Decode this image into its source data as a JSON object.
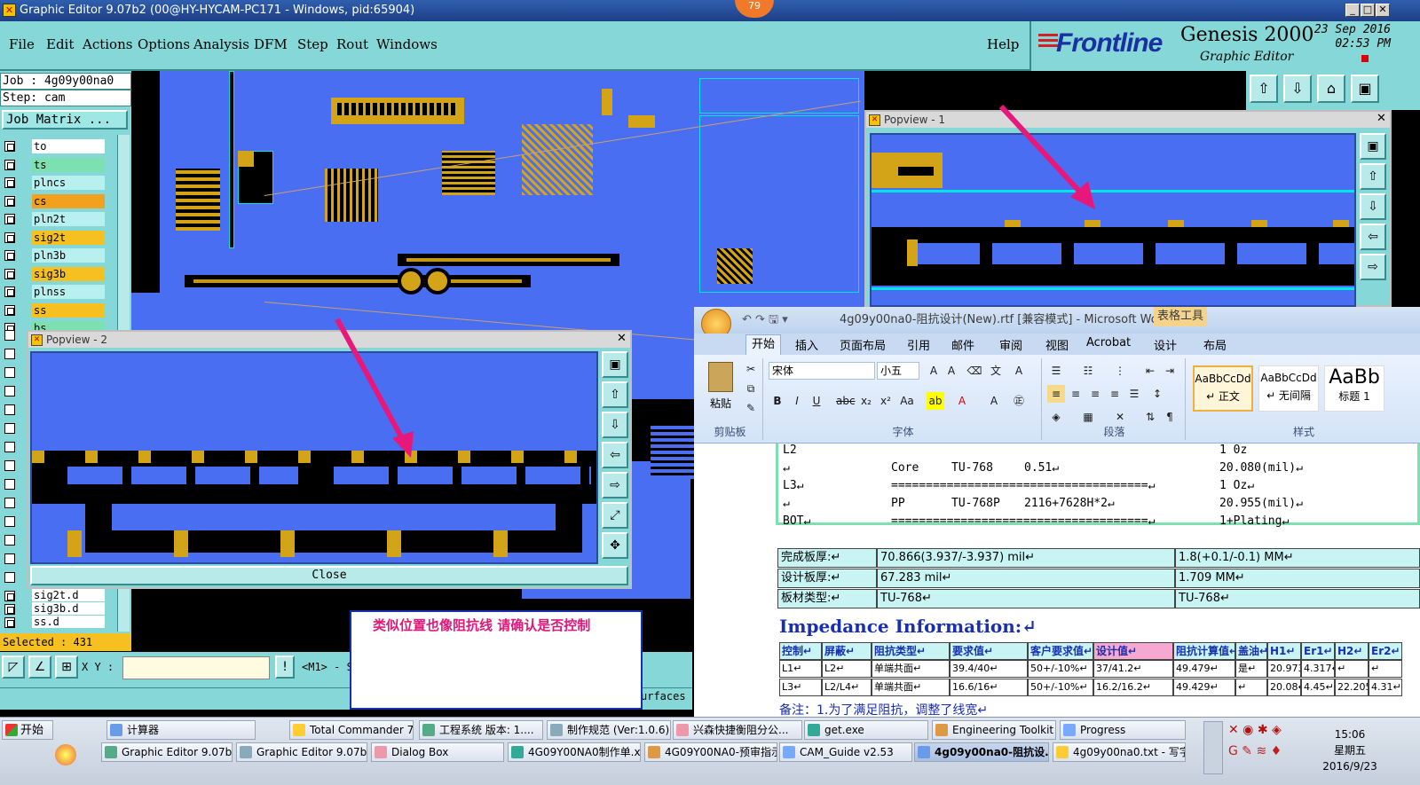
{
  "window": {
    "title": "Graphic Editor 9.07b2 (00@HY-HYCAM-PC171 - Windows, pid:65904)",
    "notification_count": "79"
  },
  "menu": [
    "File",
    "Edit",
    "Actions",
    "Options",
    "Analysis",
    "DFM",
    "Step",
    "Rout",
    "Windows"
  ],
  "help_label": "Help",
  "brand": {
    "frontline": "Frontline",
    "product": "Genesis 2000",
    "subtitle": "Graphic Editor",
    "date": "23 Sep 2016",
    "time": "02:53 PM"
  },
  "job": {
    "job_line": "Job : 4g09y00na0",
    "step_line": "Step: cam",
    "matrix_button": "Job Matrix ..."
  },
  "layers": [
    {
      "name": "to",
      "color": "white"
    },
    {
      "name": "ts",
      "color": "green"
    },
    {
      "name": "plncs",
      "color": "cyan"
    },
    {
      "name": "cs",
      "color": "red"
    },
    {
      "name": "pln2t",
      "color": "cyan"
    },
    {
      "name": "sig2t",
      "color": "yellow"
    },
    {
      "name": "pln3b",
      "color": "cyan"
    },
    {
      "name": "sig3b",
      "color": "yellow"
    },
    {
      "name": "plnss",
      "color": "cyan"
    },
    {
      "name": "ss",
      "color": "yellow"
    },
    {
      "name": "bs",
      "color": "green"
    }
  ],
  "layers_bottom": [
    "sig2t.d",
    "sig3b.d",
    "ss.d"
  ],
  "selected_label": "Selected : 431",
  "coords": {
    "xy_label": "X Y :",
    "m1_text": "<M1> - S"
  },
  "surfaces_label": "urfaces",
  "popview1": {
    "title": "Popview - 1"
  },
  "popview2": {
    "title": "Popview - 2",
    "close_label": "Close"
  },
  "note": {
    "text": "类似位置也像阻抗线 请确认是否控制"
  },
  "word": {
    "title": "4g09y00na0-阻抗设计(New).rtf [兼容模式] - Microsoft Wo...",
    "context_tab": "表格工具",
    "tabs": [
      "开始",
      "插入",
      "页面布局",
      "引用",
      "邮件",
      "审阅",
      "视图",
      "Acrobat",
      "设计",
      "布局"
    ],
    "font_name": "宋体",
    "font_size": "小五",
    "paste_label": "粘贴",
    "groups": [
      "剪贴板",
      "字体",
      "段落",
      "样式"
    ],
    "styles": [
      {
        "sample": "AaBbCcDd",
        "name": "↵ 正文"
      },
      {
        "sample": "AaBbCcDd",
        "name": "↵ 无间隔"
      },
      {
        "sample": "AaBb",
        "name": "标题 1"
      }
    ],
    "stackup": [
      {
        "c1": "L2",
        "c2": "",
        "c3": "",
        "c4": "",
        "c5": "1 0z"
      },
      {
        "c1": "↵",
        "c2": "Core",
        "c3": "TU-768",
        "c4": "0.51↵",
        "c5": "20.080(mil)↵"
      },
      {
        "c1": "L3↵",
        "c2": "=====================================↵",
        "c3": "",
        "c4": "",
        "c5": "1 Oz↵"
      },
      {
        "c1": "↵",
        "c2": "PP",
        "c3": "TU-768P",
        "c4": "2116+7628H*2↵",
        "c5": "20.955(mil)↵"
      },
      {
        "c1": "BOT↵",
        "c2": "=====================================↵",
        "c3": "",
        "c4": "",
        "c5": "1+Plating↵"
      }
    ],
    "thickness": [
      [
        "完成板厚:↵",
        "70.866(3.937/-3.937) mil↵",
        "1.8(+0.1/-0.1) MM↵"
      ],
      [
        "设计板厚:↵",
        "67.283 mil↵",
        "1.709 MM↵"
      ],
      [
        "板材类型:↵",
        "TU-768↵",
        "TU-768↵"
      ]
    ],
    "impedance_heading": "Impedance Information:↵",
    "imp_headers": [
      "控制↵",
      "屏蔽↵",
      "阻抗类型↵",
      "要求值↵",
      "客户要求值↵",
      "设计值↵",
      "阻抗计算值↵",
      "盖油↵",
      "H1↵",
      "Er1↵",
      "H2↵",
      "Er2↵"
    ],
    "imp_rows": [
      [
        "L1↵",
        "L2↵",
        "单端共面↵",
        "39.4/40↵",
        "50+/-10%↵",
        "37/41.2↵",
        "49.479↵",
        "是↵",
        "20.973",
        "4.317↵",
        "↵",
        "↵"
      ],
      [
        "L3↵",
        "L2/L4↵",
        "单端共面↵",
        "16.6/16↵",
        "50+/-10%↵",
        "16.2/16.2↵",
        "49.429↵",
        "↵",
        "20.08↵",
        "4.45↵",
        "22.205",
        "4.31↵"
      ]
    ],
    "remark": "备注：1.为了满足阻抗，调整了线宽↵"
  },
  "taskbar": {
    "start": "开始",
    "row1": [
      "计算器",
      "Total Commander 7.0 ...",
      "工程系统  版本: 1....",
      "制作规范 (Ver:1.0.6)",
      "兴森快捷衡阻分公...",
      "get.exe",
      "Engineering Toolkit 9....",
      "Progress"
    ],
    "row2": [
      "Graphic Editor 9.07b2 (...",
      "Graphic Editor 9.07b2 (...",
      "Dialog Box",
      "4G09Y00NA0制作单.xl...",
      "4G09Y00NA0-预审指示...",
      "CAM_Guide v2.53",
      "4g09y00na0-阻抗设...",
      "4g09y00na0.txt - 写字板"
    ],
    "clock_time": "15:06",
    "clock_day": "星期五",
    "clock_date": "2016/9/23"
  },
  "colors": {
    "board_blue": "#4a6ef2",
    "copper": "#d4a418",
    "ui_cyan": "#86d7d7",
    "arrow": "#e8187a"
  }
}
